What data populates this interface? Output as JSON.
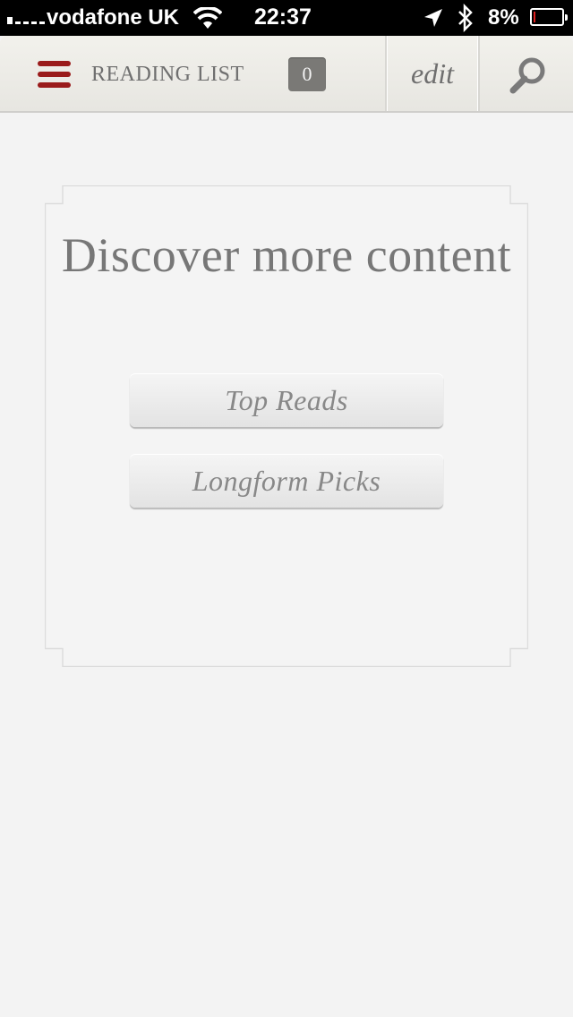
{
  "status_bar": {
    "carrier": "vodafone UK",
    "time": "22:37",
    "battery_percent": "8%",
    "battery_level": 0.08
  },
  "header": {
    "title": "READING LIST",
    "count": "0",
    "edit_label": "edit"
  },
  "card": {
    "title": "Discover more content",
    "buttons": [
      {
        "label": "Top Reads"
      },
      {
        "label": "Longform Picks"
      }
    ]
  },
  "colors": {
    "accent": "#9a1b1b",
    "background": "#f3f3f3",
    "text_muted": "#777777",
    "battery_low": "#e02020"
  }
}
